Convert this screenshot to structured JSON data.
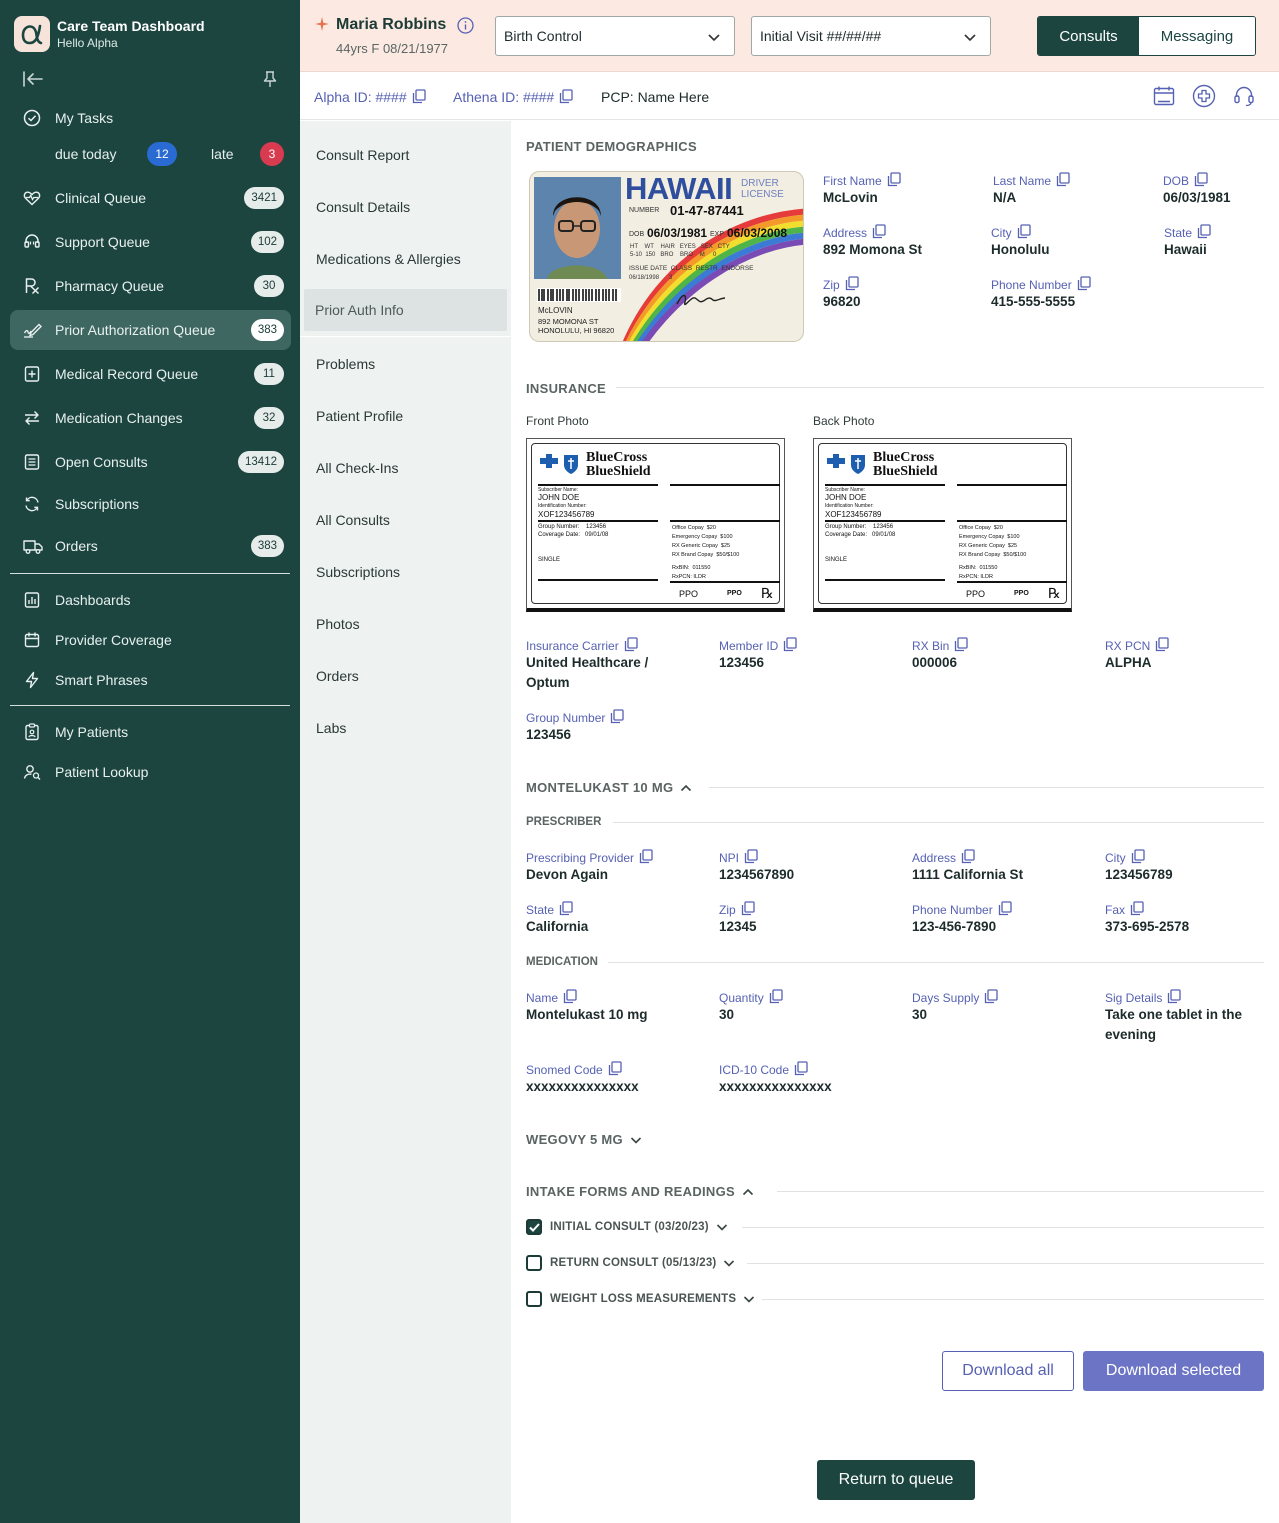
{
  "app": {
    "title": "Care Team Dashboard",
    "greeting": "Hello Alpha"
  },
  "sidebar": {
    "my_tasks": "My Tasks",
    "due_today_label": "due today",
    "due_today_count": "12",
    "late_label": "late",
    "late_count": "3",
    "items": [
      {
        "label": "Clinical Queue",
        "count": "3421",
        "icon": "heart-pulse-icon"
      },
      {
        "label": "Support Queue",
        "count": "102",
        "icon": "headset-icon"
      },
      {
        "label": "Pharmacy Queue",
        "count": "30",
        "icon": "rx-icon"
      },
      {
        "label": "Prior Authorization Queue",
        "count": "383",
        "icon": "pen-link-icon"
      },
      {
        "label": "Medical Record Queue",
        "count": "11",
        "icon": "file-plus-icon"
      },
      {
        "label": "Medication Changes",
        "count": "32",
        "icon": "arrows-swap-icon"
      },
      {
        "label": "Open Consults",
        "count": "13412",
        "icon": "list-doc-icon"
      },
      {
        "label": "Subscriptions",
        "count": "",
        "icon": "refresh-icon"
      },
      {
        "label": "Orders",
        "count": "383",
        "icon": "truck-icon"
      }
    ],
    "secondary": [
      {
        "label": "Dashboards",
        "icon": "bar-chart-icon"
      },
      {
        "label": "Provider Coverage",
        "icon": "calendar-icon"
      },
      {
        "label": "Smart Phrases",
        "icon": "lightning-icon"
      }
    ],
    "tertiary": [
      {
        "label": "My Patients",
        "icon": "clipboard-user-icon"
      },
      {
        "label": "Patient Lookup",
        "icon": "user-search-icon"
      }
    ]
  },
  "patient": {
    "name": "Maria Robbins",
    "meta": "44yrs F 08/21/1977",
    "alpha_id": "Alpha ID: ####",
    "athena_id": "Athena ID: ####",
    "pcp": "PCP: Name Here"
  },
  "header": {
    "condition_select": "Birth Control",
    "visit_select": "Initial Visit ##/##/##",
    "tab_consults": "Consults",
    "tab_messaging": "Messaging"
  },
  "subnav": [
    "Consult Report",
    "Consult Details",
    "Medications & Allergies",
    "Prior Auth Info",
    "Problems",
    "Patient Profile",
    "All Check-Ins",
    "All Consults",
    "Subscriptions",
    "Photos",
    "Orders",
    "Labs"
  ],
  "demographics": {
    "title": "PATIENT DEMOGRAPHICS",
    "id_card": {
      "state": "HAWAII",
      "type_line1": "DRIVER",
      "type_line2": "LICENSE",
      "number_label": "NUMBER",
      "number": "01-47-87441",
      "dob_label": "DOB",
      "dob": "06/03/1981",
      "exp_label": "EXP",
      "exp": "06/03/2008",
      "attr_headers": "HT    WT    HAIR   EYES   SEX   CTY",
      "attr_values": "5-10  150   BRO    BRO    M     0",
      "issue_line": "ISSUE DATE  CLASS  RESTR  ENDORSE",
      "issue_values": "06/18/1998      3",
      "name": "McLOVIN",
      "addr1": "892 MOMONA ST",
      "addr2": "HONOLULU, HI 96820",
      "signature": "McLovin"
    },
    "fields": [
      {
        "label": "First Name",
        "value": "McLovin"
      },
      {
        "label": "Last Name",
        "value": "N/A"
      },
      {
        "label": "DOB",
        "value": "06/03/1981"
      },
      {
        "label": "Address",
        "value": "892 Momona St"
      },
      {
        "label": "City",
        "value": "Honolulu"
      },
      {
        "label": "State",
        "value": "Hawaii"
      },
      {
        "label": "Zip",
        "value": "96820"
      },
      {
        "label": "Phone Number",
        "value": "415-555-5555"
      }
    ]
  },
  "insurance": {
    "title": "INSURANCE",
    "front_label": "Front Photo",
    "back_label": "Back Photo",
    "card": {
      "brand1": "BlueCross",
      "brand2": "BlueShield",
      "subscriber_label": "Subscriber Name:",
      "subscriber": "JOHN DOE",
      "id_label": "Identification Number:",
      "id": "XOF123456789",
      "group_line": "Group Number:    123456",
      "coverage_line": "Coverage Date:   09/01/08",
      "plan": "SINGLE",
      "copays": [
        "Office Copay  $20",
        "Emergency Copay  $100",
        "RX Generic Copay  $25",
        "RX Brand Copay  $50/$100"
      ],
      "rxbin": "RxBIN:  011550",
      "rxpcn": "RxPCN: ILDR",
      "ppo": "PPO",
      "ppo_logo": "PPO",
      "rx": "℞"
    },
    "fields": [
      {
        "label": "Insurance Carrier",
        "value": "United Healthcare / Optum"
      },
      {
        "label": "Member ID",
        "value": "123456"
      },
      {
        "label": "RX Bin",
        "value": "000006"
      },
      {
        "label": "RX PCN",
        "value": "ALPHA"
      },
      {
        "label": "Group Number",
        "value": "123456"
      }
    ]
  },
  "montelukast": {
    "title": "MONTELUKAST 10 MG",
    "prescriber_title": "PRESCRIBER",
    "prescriber": [
      {
        "label": "Prescribing Provider",
        "value": "Devon Again"
      },
      {
        "label": "NPI",
        "value": "1234567890"
      },
      {
        "label": "Address",
        "value": "1111 California St"
      },
      {
        "label": "City",
        "value": "123456789"
      },
      {
        "label": "State",
        "value": "California"
      },
      {
        "label": "Zip",
        "value": "12345"
      },
      {
        "label": "Phone Number",
        "value": "123-456-7890"
      },
      {
        "label": "Fax",
        "value": "373-695-2578"
      }
    ],
    "medication_title": "MEDICATION",
    "medication": [
      {
        "label": "Name",
        "value": "Montelukast 10 mg"
      },
      {
        "label": "Quantity",
        "value": "30"
      },
      {
        "label": "Days Supply",
        "value": "30"
      },
      {
        "label": "Sig Details",
        "value": "Take one tablet in the evening"
      },
      {
        "label": "Snomed Code",
        "value": "xxxxxxxxxxxxxxx"
      },
      {
        "label": "ICD-10 Code",
        "value": "xxxxxxxxxxxxxxx"
      }
    ]
  },
  "wegovy": {
    "title": "WEGOVY 5 MG"
  },
  "intake": {
    "title": "INTAKE FORMS AND READINGS",
    "items": [
      {
        "label": "INITIAL CONSULT (03/20/23)",
        "checked": true
      },
      {
        "label": "RETURN CONSULT (05/13/23)",
        "checked": false
      },
      {
        "label": "WEIGHT LOSS MEASUREMENTS",
        "checked": false
      }
    ]
  },
  "actions": {
    "download_all": "Download all",
    "download_selected": "Download selected",
    "return_to_queue": "Return to queue"
  },
  "colors": {
    "sidebar": "#1c4540",
    "accent": "#5661b3",
    "header": "#fbe9e2",
    "due_today_badge": "#2a6ad3",
    "late_badge": "#d83b4f"
  }
}
